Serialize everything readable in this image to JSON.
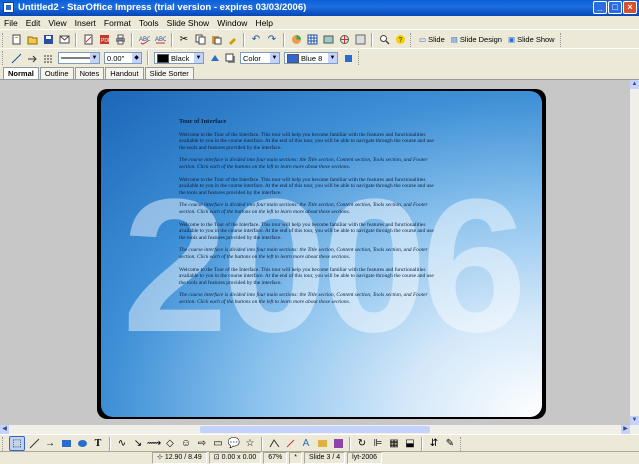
{
  "window": {
    "title": "Untitled2 - StarOffice Impress (trial version - expires 03/03/2006)"
  },
  "menu": [
    "File",
    "Edit",
    "View",
    "Insert",
    "Format",
    "Tools",
    "Slide Show",
    "Window",
    "Help"
  ],
  "toolbar": {
    "slide_label": "Slide",
    "slide_design_label": "Slide Design",
    "slide_show_label": "Slide Show"
  },
  "format_bar": {
    "line_width": "0.00\"",
    "line_color": "Black",
    "area_style": "Color",
    "area_color": "Blue 8",
    "colors": {
      "line": "#000000",
      "area": "#3366cc"
    }
  },
  "tabs": [
    "Normal",
    "Outline",
    "Notes",
    "Handout",
    "Slide Sorter"
  ],
  "slide": {
    "big_number": "2006",
    "heading": "Tour of Interface",
    "paragraphs": [
      "Welcome to the Tour of the Interface. This tour will help you become familiar with the features and functionalities available to you in the course interface. At the end of this tour, you will be able to navigate through the course and use the tools and features provided by the interface.",
      "The course interface is divided into four main sections: the Title section, Content section, Tools section, and Footer section. Click each of the buttons on the left to learn more about these sections.",
      "Welcome to the Tour of the Interface. This tour will help you become familiar with the features and functionalities available to you in the course interface. At the end of this tour, you will be able to navigate through the course and use the tools and features provided by the interface.",
      "The course interface is divided into four main sections: the Title section, Content section, Tools section, and Footer section. Click each of the buttons on the left to learn more about these sections.",
      "Welcome to the Tour of the Interface. This tour will help you become familiar with the features and functionalities available to you in the course interface. At the end of this tour, you will be able to navigate through the course and use the tools and features provided by the interface.",
      "The course interface is divided into four main sections: the Title section, Content section, Tools section, and Footer section. Click each of the buttons on the left to learn more about these sections.",
      "Welcome to the Tour of the Interface. This tour will help you become familiar with the features and functionalities available to you in the course interface. At the end of this tour, you will be able to navigate through the course and use the tools and features provided by the interface.",
      "The course interface is divided into four main sections: the Title section, Content section, Tools section, and Footer section. Click each of the buttons on the left to learn more about these sections."
    ]
  },
  "status": {
    "position": "12.90 / 8.49",
    "size": "0.00 x 0.00",
    "zoom": "67%",
    "modified": "*",
    "slide": "Slide 3 / 4",
    "layout": "lyt-2006"
  }
}
